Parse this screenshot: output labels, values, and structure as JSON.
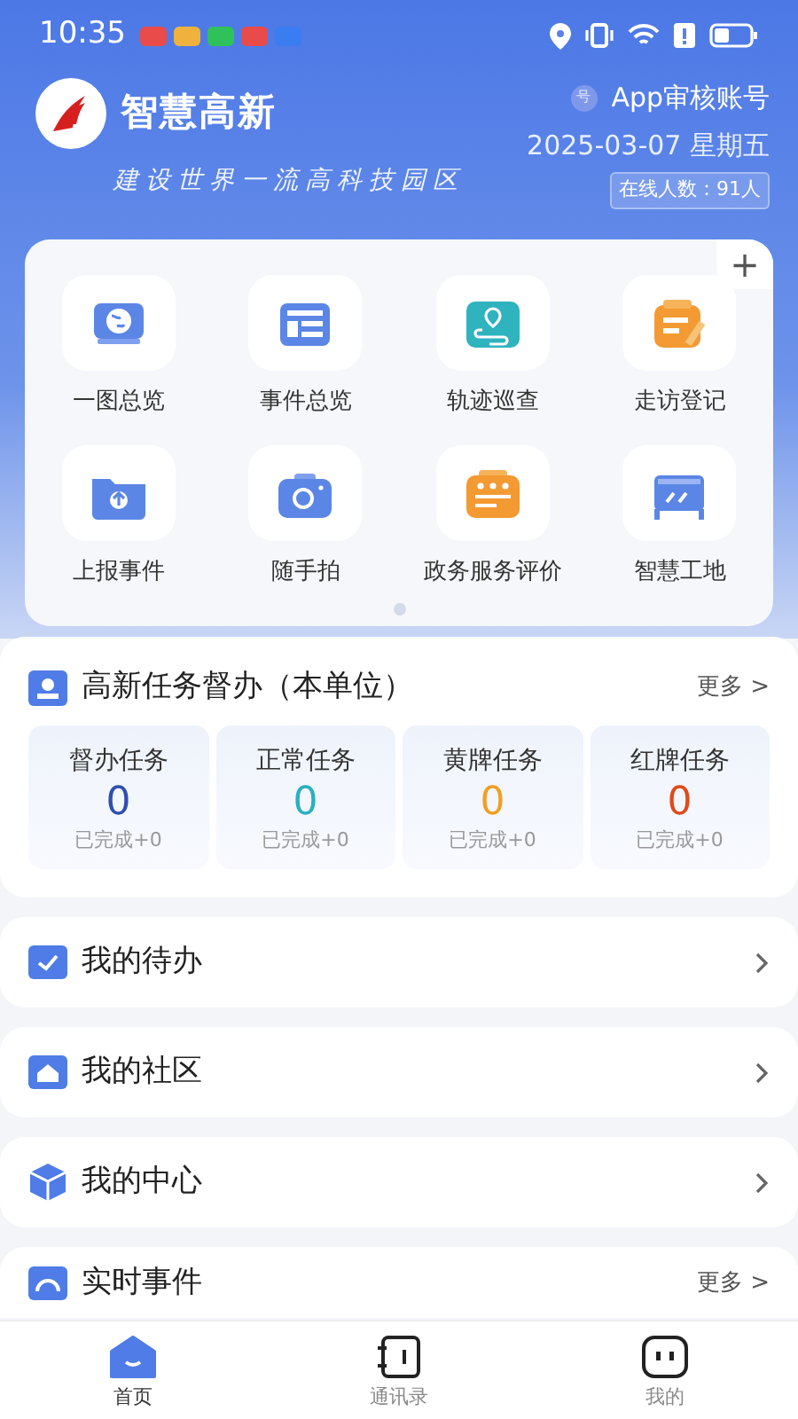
{
  "status_bar": {
    "time": "10:35",
    "notifications": [
      {
        "color": "#e94a4a"
      },
      {
        "color": "#f0b23c"
      },
      {
        "color": "#2fc15a"
      },
      {
        "color": "#e94a4a"
      },
      {
        "color": "#3a7df0"
      }
    ]
  },
  "header": {
    "title": "智慧高新",
    "slogan": "建设世界一流高科技园区",
    "account_badge": "号",
    "account": "App审核账号",
    "date": "2025-03-07 星期五",
    "online": "在线人数：91人"
  },
  "shortcuts": [
    {
      "label": "一图总览"
    },
    {
      "label": "事件总览"
    },
    {
      "label": "轨迹巡查"
    },
    {
      "label": "走访登记"
    },
    {
      "label": "上报事件"
    },
    {
      "label": "随手拍"
    },
    {
      "label": "政务服务评价"
    },
    {
      "label": "智慧工地"
    }
  ],
  "add_button": "+",
  "pager": [
    {
      "selected": true
    }
  ],
  "task_panel": {
    "title": "高新任务督办（本单位）",
    "more": "更多 >",
    "stats": [
      {
        "label": "督办任务",
        "value": "0",
        "done": "已完成+0",
        "color": "#2f4fb0"
      },
      {
        "label": "正常任务",
        "value": "0",
        "done": "已完成+0",
        "color": "#2ab0c0"
      },
      {
        "label": "黄牌任务",
        "value": "0",
        "done": "已完成+0",
        "color": "#f0a020"
      },
      {
        "label": "红牌任务",
        "value": "0",
        "done": "已完成+0",
        "color": "#e04a1a"
      }
    ]
  },
  "menu_rows": [
    {
      "label": "我的待办"
    },
    {
      "label": "我的社区"
    },
    {
      "label": "我的中心"
    }
  ],
  "events": {
    "title": "实时事件",
    "more": "更多 >"
  },
  "tab_bar": [
    {
      "label": "首页",
      "selected": true
    },
    {
      "label": "通讯录",
      "selected": false
    },
    {
      "label": "我的",
      "selected": false
    }
  ]
}
